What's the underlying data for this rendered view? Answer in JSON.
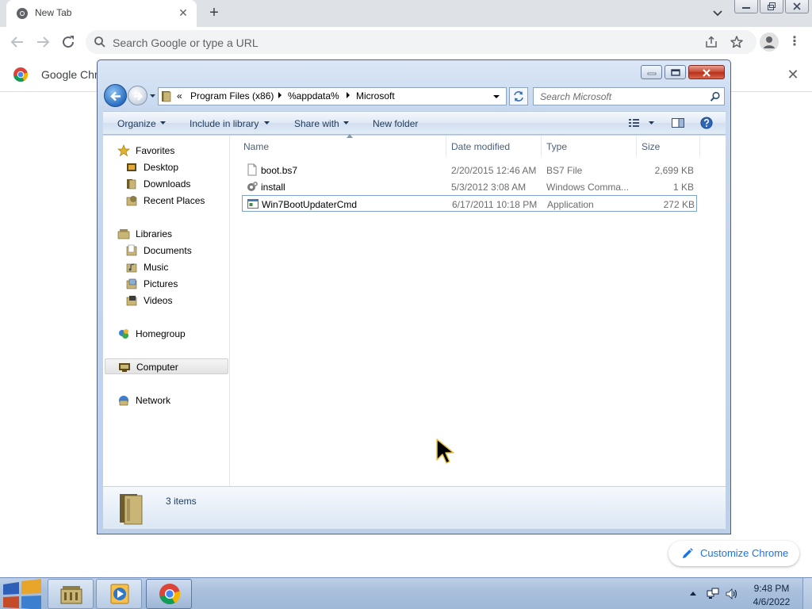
{
  "browser": {
    "tab": {
      "title": "New Tab"
    },
    "omnibox": {
      "placeholder": "Search Google or type a URL"
    },
    "infobar": {
      "text": "Google Chro"
    },
    "customize": {
      "label": "Customize Chrome",
      "color": "#1a73e8"
    }
  },
  "explorer": {
    "breadcrumbs": [
      "Program Files (x86)",
      "%appdata%",
      "Microsoft"
    ],
    "breadcrumb_overflow": "«",
    "search": {
      "placeholder": "Search Microsoft"
    },
    "commands": {
      "organize": "Organize",
      "include_in_library": "Include in library",
      "share_with": "Share with",
      "new_folder": "New folder"
    },
    "nav": {
      "favorites": "Favorites",
      "desktop": "Desktop",
      "downloads": "Downloads",
      "recent_places": "Recent Places",
      "libraries": "Libraries",
      "documents": "Documents",
      "music": "Music",
      "pictures": "Pictures",
      "videos": "Videos",
      "homegroup": "Homegroup",
      "computer": "Computer",
      "network": "Network"
    },
    "columns": {
      "name": "Name",
      "date_modified": "Date modified",
      "type": "Type",
      "size": "Size"
    },
    "files": [
      {
        "name": "boot.bs7",
        "date": "2/20/2015 12:46 AM",
        "type": "BS7 File",
        "size": "2,699 KB",
        "icon": "file-icon"
      },
      {
        "name": "install",
        "date": "5/3/2012 3:08 AM",
        "type": "Windows Comma...",
        "size": "1 KB",
        "icon": "gear-script-icon"
      },
      {
        "name": "Win7BootUpdaterCmd",
        "date": "6/17/2011 10:18 PM",
        "type": "Application",
        "size": "272 KB",
        "icon": "application-icon"
      }
    ],
    "status": {
      "items": "3 items"
    }
  },
  "taskbar": {
    "clock": {
      "time": "9:48 PM",
      "date": "4/6/2022"
    }
  }
}
